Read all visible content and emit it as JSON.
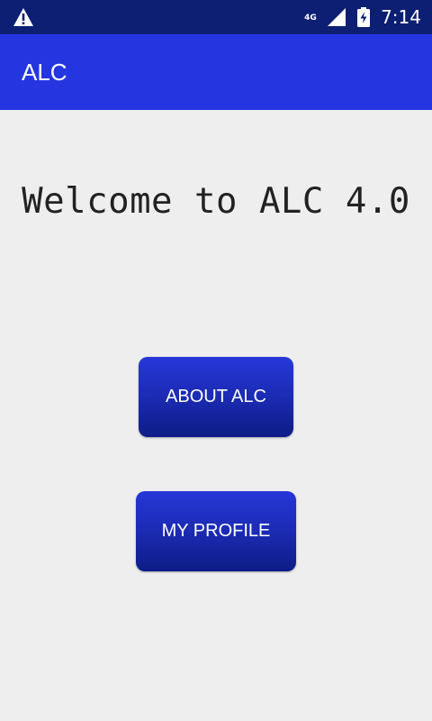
{
  "status_bar": {
    "time": "7:14",
    "network": "4G",
    "icons": [
      "warning-icon",
      "signal-icon",
      "battery-charging-icon"
    ]
  },
  "app_bar": {
    "title": "ALC"
  },
  "main": {
    "welcome_text": "Welcome to ALC 4.0",
    "buttons": {
      "about_label": "ABOUT ALC",
      "profile_label": "MY PROFILE"
    }
  },
  "colors": {
    "status_bar": "#0c1f73",
    "app_bar": "#2536e0",
    "background": "#eeeeee",
    "button_gradient_top": "#2637d9",
    "button_gradient_bottom": "#0e1c86"
  }
}
